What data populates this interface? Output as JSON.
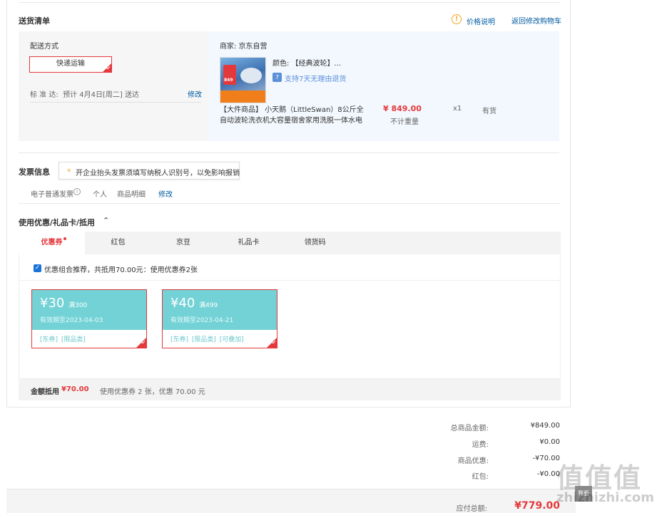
{
  "delivery": {
    "title": "送货清单",
    "price_note_link": "价格说明",
    "back_cart_link": "返回修改购物车",
    "method_label": "配送方式",
    "method_option": "快递运输",
    "standard_text": "标 准 达:  预计 4月4日[周二] 送达",
    "modify_link": "修改",
    "shop_label": "商家:  京东自营",
    "product_color": "颜色:  【经典波轮】...",
    "return_badge": "7",
    "return_policy": "支持7天无理由退货",
    "product_name_line1": "【大件商品】 小天鹅（LittleSwan）8公斤全",
    "product_name_line2": "自动波轮洗衣机大容量宿舍家用洗脱一体水电",
    "price": "¥ 849.00",
    "weight_note": "不计重量",
    "quantity": "x1",
    "stock": "有货",
    "thumbnail_badge_text": "849"
  },
  "invoice": {
    "title": "发票信息",
    "tooltip": "开企业抬头发票须填写纳税人识别号，以免影响报销",
    "type": "电子普通发票",
    "holder": "个人",
    "content": "商品明细",
    "modify_link": "修改"
  },
  "coupons": {
    "section_title": "使用优惠/礼品卡/抵用",
    "tabs": [
      "优惠券",
      "红包",
      "京豆",
      "礼品卡",
      "领货码"
    ],
    "recommend_text": "优惠组合推荐，共抵用70.00元：使用优惠券2张",
    "items": [
      {
        "amount": "¥30",
        "condition": "满300",
        "expiry": "有效期至2023-04-03",
        "tags": "[东券]  [限品类]"
      },
      {
        "amount": "¥40",
        "condition": "满499",
        "expiry": "有效期至2023-04-21",
        "tags": "[东券]  [限品类]  [可叠加]"
      }
    ],
    "discount_label": "金额抵用",
    "discount_amount": "¥70.00",
    "discount_detail": "使用优惠券 2 张，优惠 70.00 元"
  },
  "summary": {
    "goods_total_label": "总商品金额:",
    "goods_total": "¥849.00",
    "shipping_label": "运费:",
    "shipping": "¥0.00",
    "discount_label": "商品优惠:",
    "discount": "-¥70.00",
    "redpacket_label": "红包:",
    "redpacket": "-¥0.00",
    "payable_label": "应付总额:",
    "payable": "¥779.00"
  },
  "watermark": {
    "logo": "值值值",
    "url": "zhizhizhi.com",
    "side_button": "我要"
  },
  "colors": {
    "accent_red": "#e4393c",
    "link_blue": "#005aa0",
    "coupon_teal": "#73d2d6"
  }
}
